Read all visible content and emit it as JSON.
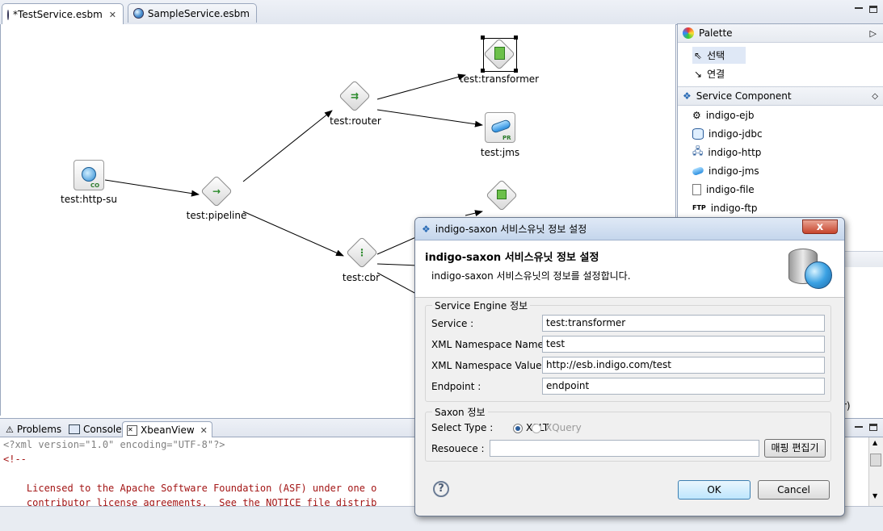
{
  "editor_tabs": [
    {
      "label": "*TestService.esbm",
      "active": true
    },
    {
      "label": "SampleService.esbm",
      "active": false
    }
  ],
  "diagram": {
    "nodes": {
      "http_su": "test:http-su",
      "pipeline": "test:pipeline",
      "router": "test:router",
      "transformer": "test:transformer",
      "jms": "test:jms",
      "cbr": "test:cbr"
    },
    "badges": {
      "co": "CO",
      "pr": "PR"
    }
  },
  "palette": {
    "title": "Palette",
    "tools": [
      {
        "label": "선택",
        "icon": "arrow-pointer-icon"
      },
      {
        "label": "연결",
        "icon": "connection-icon"
      }
    ],
    "section": "Service Component",
    "components": [
      {
        "label": "indigo-ejb",
        "icon": "gear-icon"
      },
      {
        "label": "indigo-jdbc",
        "icon": "database-icon"
      },
      {
        "label": "indigo-http",
        "icon": "network-icon"
      },
      {
        "label": "indigo-jms",
        "icon": "pipe-icon"
      },
      {
        "label": "indigo-file",
        "icon": "file-icon"
      },
      {
        "label": "indigo-ftp",
        "icon": "ftp-icon"
      }
    ],
    "hidden_hint": "r)"
  },
  "bottom_tabs": [
    {
      "label": "Problems",
      "icon": "problems-icon"
    },
    {
      "label": "Console",
      "icon": "console-icon"
    },
    {
      "label": "XbeanView",
      "icon": "xbean-icon",
      "active": true
    }
  ],
  "xml_lines": [
    {
      "text": "<?xml version=\"1.0\" encoding=\"UTF-8\"?>",
      "color": "#808080"
    },
    {
      "text": "<!--",
      "color": "#a31515"
    },
    {
      "text": "",
      "color": "#a31515"
    },
    {
      "text": "    Licensed to the Apache Software Foundation (ASF) under one o",
      "color": "#a31515"
    },
    {
      "text": "    contributor license agreements.  See the NOTICE file distrib",
      "color": "#a31515"
    }
  ],
  "dialog": {
    "title": "indigo-saxon 서비스유닛 정보 설정",
    "close_label": "x",
    "header_title": "indigo-saxon 서비스유닛 정보 설정",
    "header_desc": "indigo-saxon 서비스유닛의 정보를 설정합니다.",
    "engine_group": "Service Engine 정보",
    "fields": [
      {
        "label": "Service :",
        "value": "test:transformer"
      },
      {
        "label": "XML Namespace Name :",
        "value": "test"
      },
      {
        "label": "XML Namespace Value :",
        "value": "http://esb.indigo.com/test"
      },
      {
        "label": "Endpoint :",
        "value": "endpoint"
      }
    ],
    "saxon_group": "Saxon 정보",
    "select_type_label": "Select Type :",
    "select_options": [
      {
        "label": "XSLT",
        "selected": true
      },
      {
        "label": "XQuery",
        "selected": false
      }
    ],
    "resource_label": "Resouece :",
    "resource_value": "",
    "mapping_button": "매핑 편집기",
    "ok_button": "OK",
    "cancel_button": "Cancel"
  }
}
